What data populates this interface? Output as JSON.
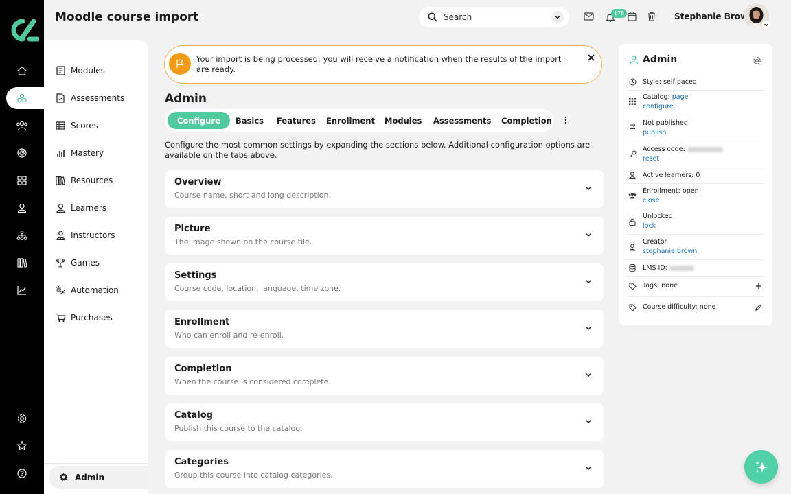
{
  "header": {
    "title": "Moodle course import",
    "search_label": "Search",
    "notification_count": "178",
    "user_name": "Stephanie Brown"
  },
  "rail": {
    "icons": [
      "home-icon",
      "modules-icon",
      "people-icon",
      "target-icon",
      "apps-icon",
      "user-icon",
      "hierarchy-icon",
      "library-icon",
      "analytics-icon",
      "settings-icon",
      "star-icon",
      "help-icon"
    ]
  },
  "nav": {
    "items": [
      {
        "label": "Modules",
        "icon": "book-icon"
      },
      {
        "label": "Assessments",
        "icon": "document-check-icon"
      },
      {
        "label": "Scores",
        "icon": "table-icon"
      },
      {
        "label": "Mastery",
        "icon": "bar-chart-icon"
      },
      {
        "label": "Resources",
        "icon": "library-icon"
      },
      {
        "label": "Learners",
        "icon": "user-icon"
      },
      {
        "label": "Instructors",
        "icon": "instructor-icon"
      },
      {
        "label": "Games",
        "icon": "trophy-icon"
      },
      {
        "label": "Automation",
        "icon": "gears-icon"
      },
      {
        "label": "Purchases",
        "icon": "cart-icon"
      }
    ],
    "admin_label": "Admin"
  },
  "alert": {
    "text": "Your import is being processed; you will receive a notification when the results of the import are ready."
  },
  "main": {
    "section_title": "Admin",
    "tabs": [
      "Configure",
      "Basics",
      "Features",
      "Enrollment",
      "Modules",
      "Assessments",
      "Completion"
    ],
    "active_tab": "Configure",
    "intro": "Configure the most common settings by expanding the sections below. Additional configuration options are available on the tabs above.",
    "cards": [
      {
        "title": "Overview",
        "desc": "Course name, short and long description."
      },
      {
        "title": "Picture",
        "desc": "The image shown on the course tile."
      },
      {
        "title": "Settings",
        "desc": "Course code, location, language, time zone."
      },
      {
        "title": "Enrollment",
        "desc": "Who can enroll and re-enroll."
      },
      {
        "title": "Completion",
        "desc": "When the course is considered complete."
      },
      {
        "title": "Catalog",
        "desc": "Publish this course to the catalog."
      },
      {
        "title": "Categories",
        "desc": "Group this course into catalog categories."
      }
    ]
  },
  "panel": {
    "title": "Admin",
    "style": "Style: self paced",
    "catalog_label": "Catalog:",
    "catalog_link": "page",
    "catalog_configure": "configure",
    "publish_status": "Not published",
    "publish_link": "publish",
    "access_code_label": "Access code:",
    "access_reset": "reset",
    "active_learners": "Active learners: 0",
    "enrollment_status": "Enrollment: open",
    "enrollment_link": "close",
    "lock_status": "Unlocked",
    "lock_link": "lock",
    "creator_label": "Creator",
    "creator_link": "stephanie brown",
    "lms_id_label": "LMS ID:",
    "tags": "Tags: none",
    "difficulty": "Course difficulty: none"
  },
  "colors": {
    "accent": "#4fc99e",
    "warning": "#f49b16",
    "link": "#1a73c7"
  }
}
